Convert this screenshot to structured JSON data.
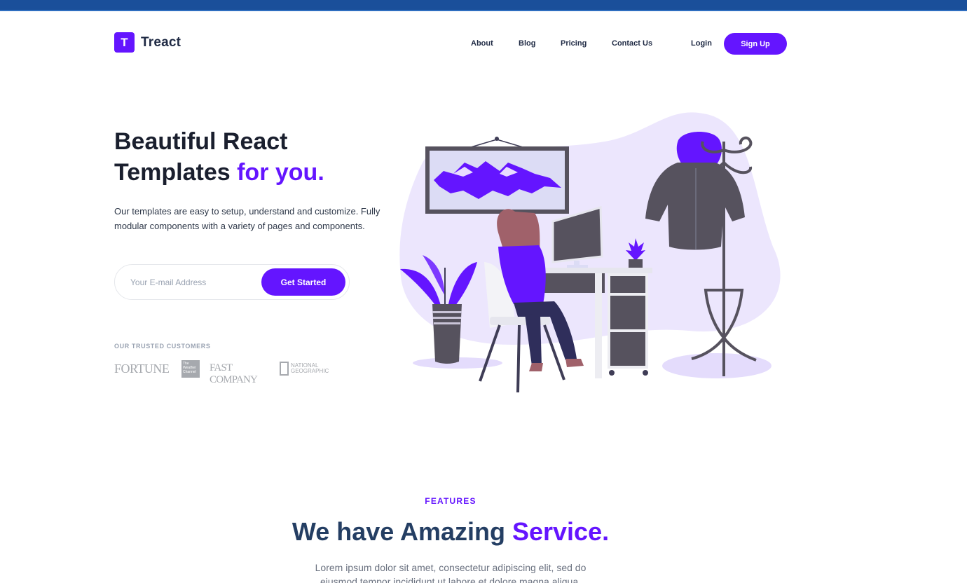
{
  "colors": {
    "primary": "#6415ff",
    "heading": "#1a1f2e",
    "topbar": "#1a4f9a",
    "muted": "#9aa3b2"
  },
  "brand": {
    "initial": "T",
    "name": "Treact"
  },
  "nav": {
    "links": [
      "About",
      "Blog",
      "Pricing",
      "Contact Us"
    ],
    "login": "Login",
    "signup": "Sign Up"
  },
  "hero": {
    "title_line1": "Beautiful React",
    "title_line2": "Templates ",
    "title_accent": "for you.",
    "subtitle": "Our templates are easy to setup, understand and customize. Fully modular components with a variety of pages and components.",
    "email_placeholder": "Your E-mail Address",
    "cta": "Get Started",
    "trusted_label": "OUR TRUSTED CUSTOMERS",
    "customers": {
      "fortune": "FORTUNE",
      "weather": "The Weather Channel",
      "fastcompany": "FAST COMPANY",
      "natgeo_line1": "NATIONAL",
      "natgeo_line2": "GEOGRAPHIC"
    }
  },
  "features": {
    "label": "FEATURES",
    "title": "We have Amazing ",
    "title_accent": "Service.",
    "description": "Lorem ipsum dolor sit amet, consectetur adipiscing elit, sed do eiusmod tempor incididunt ut labore et dolore magna aliqua."
  }
}
